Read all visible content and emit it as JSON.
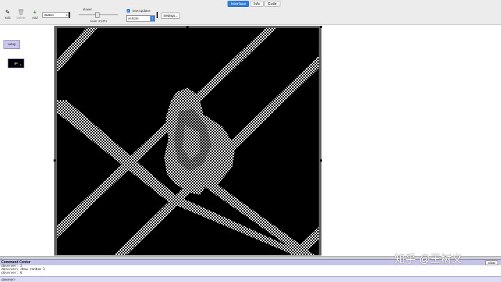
{
  "tabs": [
    "Interface",
    "Info",
    "Code"
  ],
  "active_tab": "Interface",
  "toolbar": {
    "edit_label": "Edit",
    "delete_label": "Delete",
    "add_label": "Add",
    "widget_select": "Button",
    "speed_label": "slower",
    "ticks_label": "ticks: 51474",
    "view_updates_label": "view updates",
    "view_updates_checked": true,
    "update_mode": "on ticks",
    "settings_label": "Settings..."
  },
  "widgets": {
    "setup_label": "setup",
    "go_label": "go"
  },
  "command_center": {
    "title": "Command Center",
    "clear_label": "Clear",
    "output_lines": [
      "observer: 2",
      "observer> show random 3",
      "observer: 0"
    ],
    "context": "observer>"
  },
  "watermark": "知乎 @王树义",
  "colors": {
    "active_tab": "#2f7de1",
    "button_bg": "#c9c5ec",
    "world_bg": "#000000",
    "world_pattern": "#ffffff"
  }
}
